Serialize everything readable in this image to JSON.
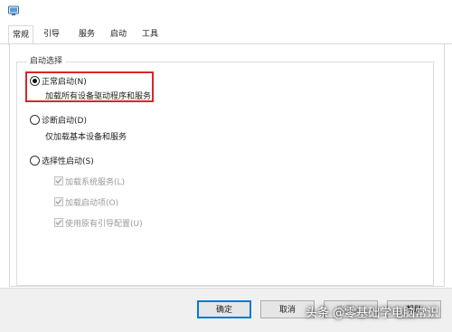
{
  "window": {
    "icon": "system-config-icon"
  },
  "tabs": [
    {
      "label": "常规",
      "active": true
    },
    {
      "label": "引导",
      "active": false
    },
    {
      "label": "服务",
      "active": false
    },
    {
      "label": "启动",
      "active": false
    },
    {
      "label": "工具",
      "active": false
    }
  ],
  "startup_group": {
    "title": "启动选择",
    "normal": {
      "label": "正常启动(N)",
      "desc": "加载所有设备驱动程序和服务",
      "selected": true
    },
    "diagnostic": {
      "label": "诊断启动(D)",
      "desc": "仅加载基本设备和服务",
      "selected": false
    },
    "selective": {
      "label": "选择性启动(S)",
      "selected": false,
      "options": [
        {
          "label": "加载系统服务(L)",
          "checked": true,
          "enabled": false
        },
        {
          "label": "加载启动项(O)",
          "checked": true,
          "enabled": false
        },
        {
          "label": "使用原有引导配置(U)",
          "checked": true,
          "enabled": false
        }
      ]
    }
  },
  "buttons": {
    "ok": "确定",
    "cancel": "取消",
    "apply": "应用(A)",
    "help": "帮助"
  },
  "watermark": "头条 @零基础学电脑常识",
  "colors": {
    "highlight": "#d6262b",
    "accent": "#0078d7"
  }
}
